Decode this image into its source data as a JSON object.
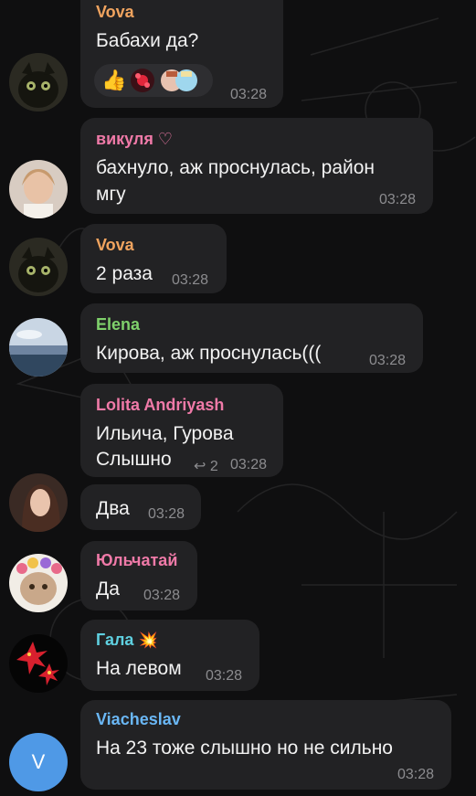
{
  "colors": {
    "background": "#0f0f10",
    "bubble": "#222224",
    "time": "#8c8c8f"
  },
  "messages": [
    {
      "sender": "Vova",
      "sender_color": "#f1a45f",
      "lines": [
        "Бабахи да?"
      ],
      "time": "03:28",
      "reactions": [
        "thumbs-up-emoji",
        "sticker-flowers",
        "sticker-girls"
      ]
    },
    {
      "sender": "викуля ♡",
      "sender_color": "#f07aa8",
      "lines": [
        "бахнуло, аж проснулась, район",
        "мгу"
      ],
      "time": "03:28"
    },
    {
      "sender": "Vova",
      "sender_color": "#f1a45f",
      "lines": [
        "2 раза"
      ],
      "time": "03:28"
    },
    {
      "sender": "Elena",
      "sender_color": "#7fd16b",
      "lines": [
        "Кирова, аж проснулась((("
      ],
      "time": "03:28"
    },
    {
      "sender": "Lolita Andriyash",
      "sender_color": "#f07aa8",
      "lines": [
        "Ильича, Гурова",
        "Слышно"
      ],
      "time": "03:28",
      "reply_count": "2"
    },
    {
      "sender": "",
      "lines": [
        "Два"
      ],
      "time": "03:28"
    },
    {
      "sender": "Юльчатай",
      "sender_color": "#f07aa8",
      "lines": [
        "Да"
      ],
      "time": "03:28"
    },
    {
      "sender": "Гала",
      "sender_color": "#5fd0e0",
      "sender_emoji": "collision-emoji",
      "lines": [
        "На левом"
      ],
      "time": "03:28"
    },
    {
      "sender": "Viacheslav",
      "sender_color": "#6ab7f5",
      "lines": [
        "На 23 тоже слышно но не сильно"
      ],
      "time": "03:28",
      "avatar_letter": "V"
    }
  ]
}
